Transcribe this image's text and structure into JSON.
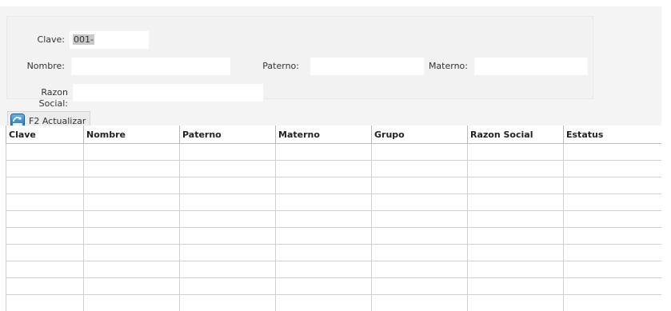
{
  "form": {
    "clave": {
      "label": "Clave:",
      "value": "001-"
    },
    "nombre": {
      "label": "Nombre:",
      "value": ""
    },
    "paterno": {
      "label": "Paterno:",
      "value": ""
    },
    "materno": {
      "label": "Materno:",
      "value": ""
    },
    "razon_social": {
      "label": "Razon Social:",
      "value": ""
    }
  },
  "toolbar": {
    "refresh_label": "F2 Actualizar",
    "refresh_icon": "refresh-icon"
  },
  "table": {
    "columns": [
      "Clave",
      "Nombre",
      "Paterno",
      "Materno",
      "Grupo",
      "Razon Social",
      "Estatus"
    ],
    "empty_rows": 10
  }
}
